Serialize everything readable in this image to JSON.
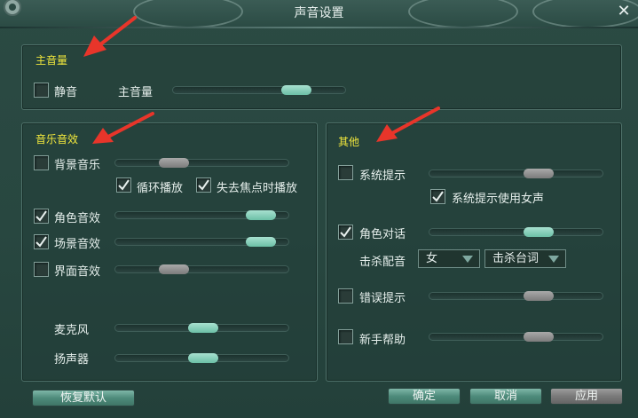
{
  "window": {
    "title": "声音设置"
  },
  "master": {
    "header": "主音量",
    "mute": {
      "label": "静音",
      "checked": false
    },
    "volume": {
      "label": "主音量",
      "level": 0.75,
      "active": true
    }
  },
  "music": {
    "header": "音乐音效",
    "bgm": {
      "label": "背景音乐",
      "checked": false,
      "level": 0.3,
      "active": false
    },
    "loop": {
      "label": "循环播放",
      "checked": true
    },
    "background_play": {
      "label": "失去焦点时播放",
      "checked": true
    },
    "role_sfx": {
      "label": "角色音效",
      "checked": true,
      "level": 0.9,
      "active": true
    },
    "scene_sfx": {
      "label": "场景音效",
      "checked": true,
      "level": 0.9,
      "active": true
    },
    "ui_sfx": {
      "label": "界面音效",
      "checked": false,
      "level": 0.3,
      "active": false
    },
    "mic": {
      "label": "麦克风",
      "level": 0.5
    },
    "speaker": {
      "label": "扬声器",
      "level": 0.5
    }
  },
  "other": {
    "header": "其他",
    "sys_tip": {
      "label": "系统提示",
      "checked": false,
      "level": 0.65,
      "active": false
    },
    "female_voice": {
      "label": "系统提示使用女声",
      "checked": true
    },
    "dialog": {
      "label": "角色对话",
      "checked": true,
      "level": 0.65,
      "active": true
    },
    "kill_voice": {
      "label": "击杀配音",
      "gender": "女",
      "lines": "击杀台词"
    },
    "error_tip": {
      "label": "错误提示",
      "checked": false,
      "level": 0.65,
      "active": false
    },
    "newbie": {
      "label": "新手帮助",
      "checked": false,
      "level": 0.65,
      "active": false
    }
  },
  "buttons": {
    "restore": "恢复默认",
    "ok": "确定",
    "cancel": "取消",
    "apply": "应用"
  },
  "colors": {
    "header": "#f2e83c",
    "slider_active": "#7fcdb3",
    "slider_inactive": "#8a8a8a",
    "annotation_arrow": "#e8352a"
  }
}
